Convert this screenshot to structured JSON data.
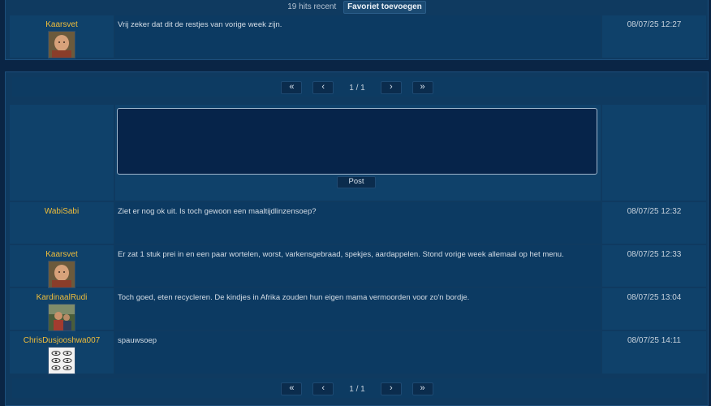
{
  "top_bar": {
    "hits_text": "19 hits recent",
    "favorite_label": "Favoriet toevoegen"
  },
  "top_post": {
    "username": "Kaarsvet",
    "avatar": "bald-man-avatar",
    "text": "Vrij zeker dat dit de restjes van vorige week zijn.",
    "date": "08/07/25 12:27"
  },
  "pager": {
    "first": "«",
    "prev": "‹",
    "info": "1 / 1",
    "next": "›",
    "last": "»"
  },
  "compose": {
    "value": "",
    "post_label": "Post"
  },
  "posts": [
    {
      "username": "WabiSabi",
      "avatar": "",
      "text": "Ziet er nog ok uit. Is toch gewoon een maaltijdlinzensoep?",
      "date": "08/07/25 12:32"
    },
    {
      "username": "Kaarsvet",
      "avatar": "bald-man-avatar",
      "text": "Er zat 1 stuk prei in en een paar wortelen, worst, varkensgebraad, spekjes, aardappelen. Stond vorige week allemaal op het menu.",
      "date": "08/07/25 12:33"
    },
    {
      "username": "KardinaalRudi",
      "avatar": "photo-avatar",
      "text": "Toch goed, eten recycleren. De kindjes in Afrika zouden hun eigen mama vermoorden voor zo'n bordje.",
      "date": "08/07/25 13:04"
    },
    {
      "username": "ChrisDusjooshwa007",
      "avatar": "eyes-avatar",
      "text": "spauwsoep",
      "date": "08/07/25 14:11"
    }
  ],
  "colors": {
    "background": "#0a2545",
    "panel": "#0f3a60",
    "username": "#f0bd3a",
    "text": "#d4dde6"
  }
}
